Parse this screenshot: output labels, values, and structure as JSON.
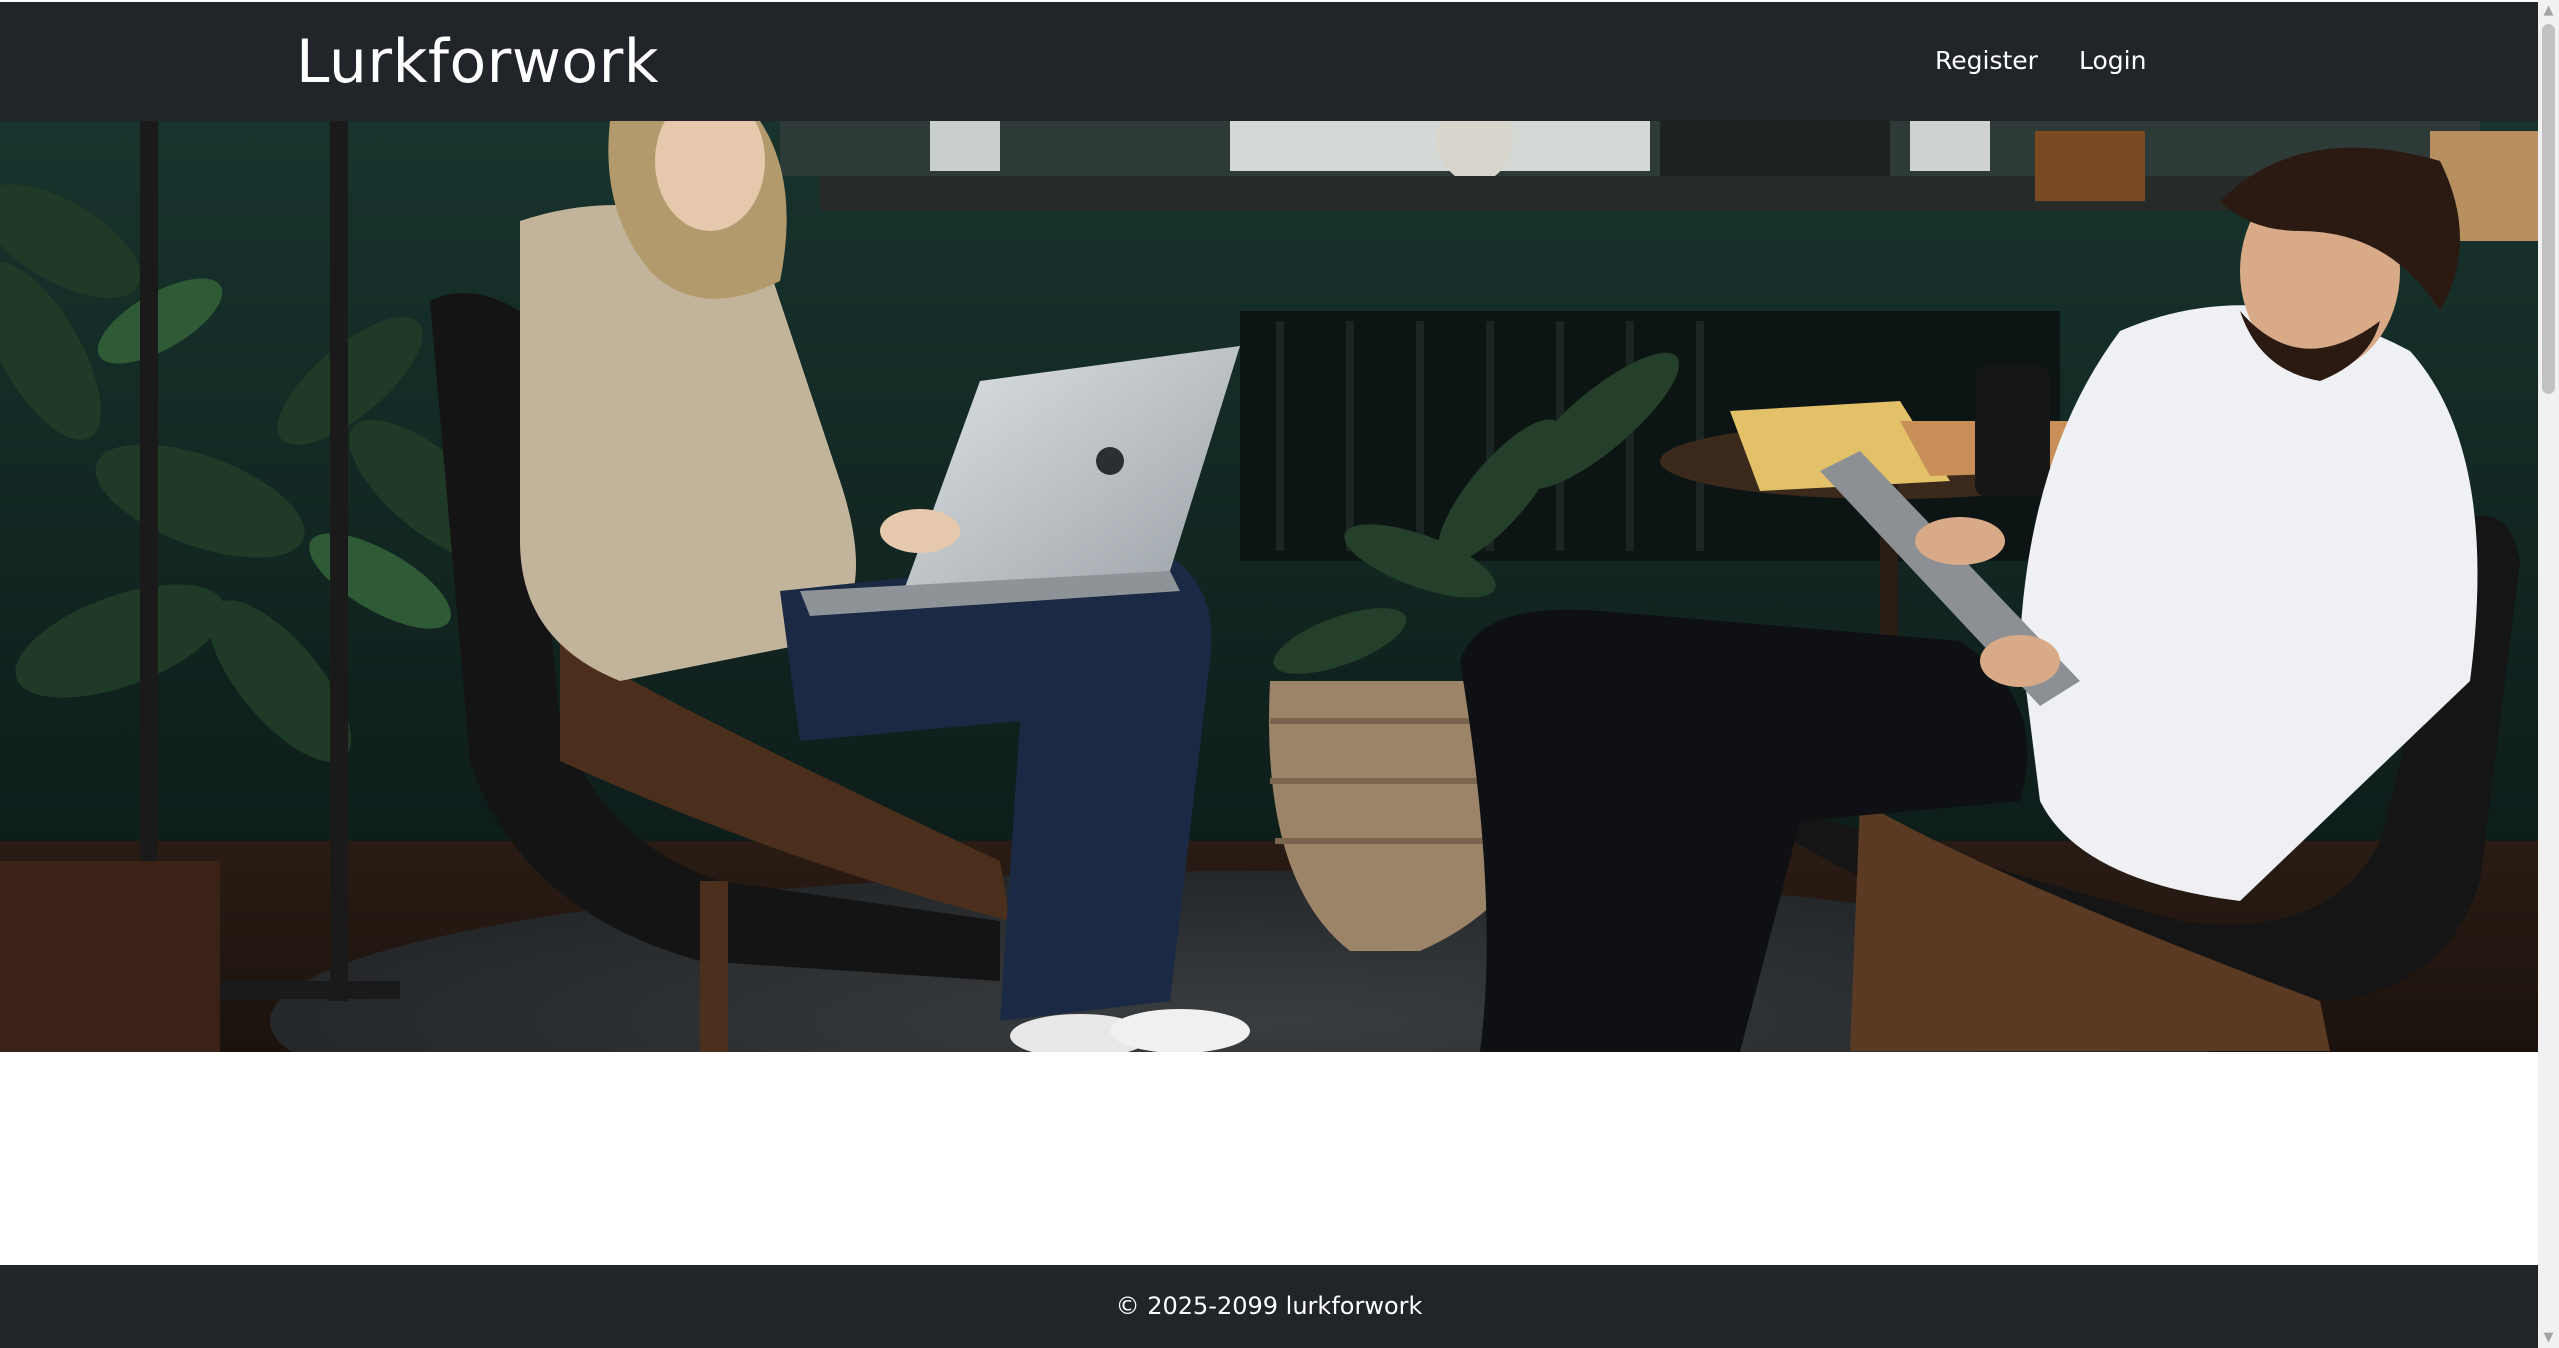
{
  "navbar": {
    "brand": "Lurkforwork",
    "links": [
      {
        "label": "Register"
      },
      {
        "label": "Login"
      }
    ]
  },
  "hero": {
    "image_alt": "Two people working in a lounge with a laptop and tablet"
  },
  "footer": {
    "copyright": "© 2025-2099 lurkforwork"
  },
  "colors": {
    "navbar_bg": "#212529",
    "footer_bg": "#212529",
    "text_light": "#ffffff",
    "page_bg": "#ffffff"
  },
  "icons": {
    "scroll_up": "triangle-up-icon",
    "scroll_down": "triangle-down-icon"
  }
}
